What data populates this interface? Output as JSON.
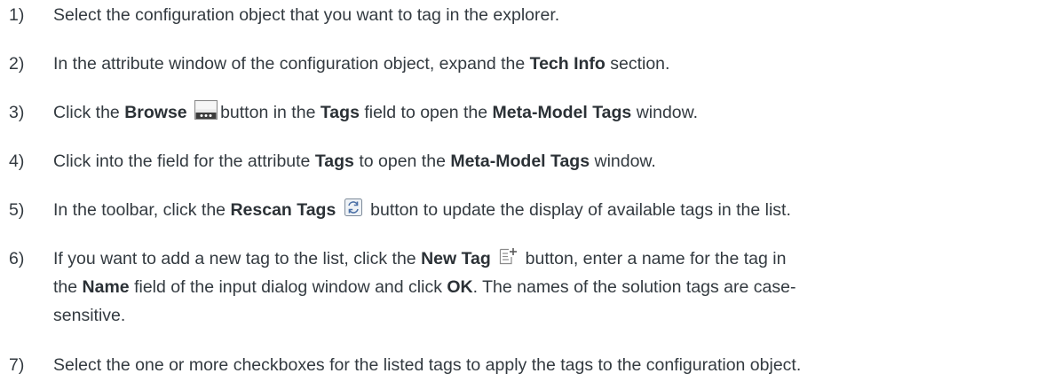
{
  "steps": [
    {
      "number": "1)",
      "lines": [
        [
          "Select the configuration object that you want to tag in the explorer."
        ]
      ]
    },
    {
      "number": "2)",
      "lines": [
        [
          "In the attribute window of the configuration object, expand the ",
          {
            "b": "Tech Info"
          },
          " section."
        ]
      ]
    },
    {
      "number": "3)",
      "lines": [
        [
          "Click the ",
          {
            "b": "Browse"
          },
          {
            "icon": "browse-icon"
          },
          "button in the ",
          {
            "b": "Tags"
          },
          " field to open the ",
          {
            "b": "Meta-Model Tags"
          },
          " window."
        ]
      ]
    },
    {
      "number": "4)",
      "lines": [
        [
          "Click into the field for the attribute ",
          {
            "b": "Tags"
          },
          " to open the ",
          {
            "b": "Meta-Model Tags"
          },
          " window."
        ]
      ]
    },
    {
      "number": "5)",
      "lines": [
        [
          "In the toolbar, click the ",
          {
            "b": "Rescan Tags"
          },
          " ",
          {
            "icon": "rescan-icon"
          },
          " button to update the display of available tags in the list."
        ]
      ]
    },
    {
      "number": "6)",
      "lines": [
        [
          "If you want to add a new tag to the list, click the ",
          {
            "b": "New Tag"
          },
          " ",
          {
            "icon": "new-tag-icon"
          },
          " button, enter a name for the tag in"
        ],
        [
          "the ",
          {
            "b": "Name"
          },
          " field of the input dialog window and click ",
          {
            "b": "OK"
          },
          ". The names of the solution tags are case-"
        ],
        [
          "sensitive."
        ]
      ]
    },
    {
      "number": "7)",
      "lines": [
        [
          "Select the one or more checkboxes for the listed tags to apply the tags to the configuration object."
        ]
      ]
    }
  ]
}
